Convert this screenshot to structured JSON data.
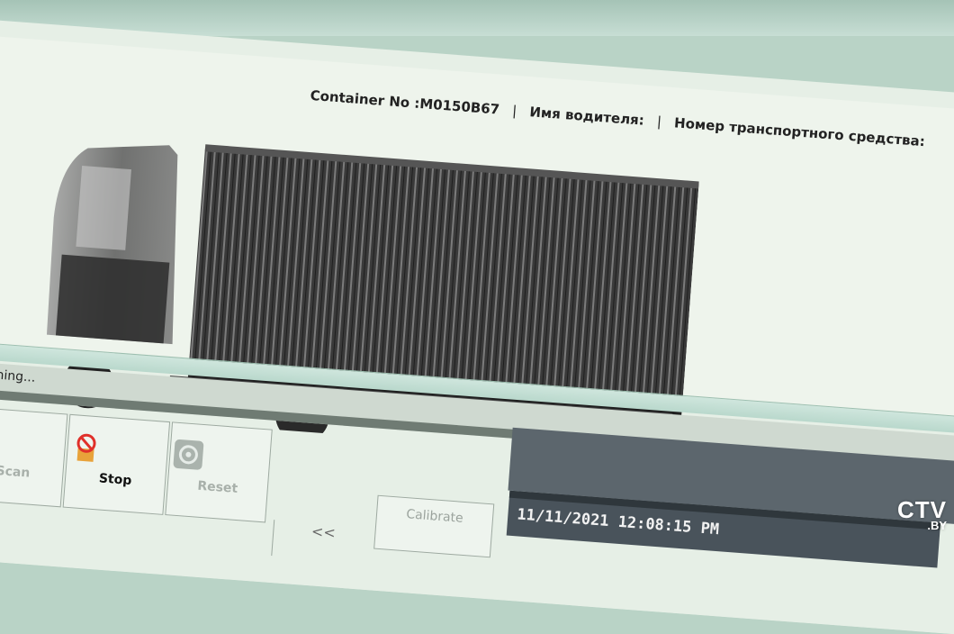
{
  "scan_window": {
    "info_bar": {
      "container_label": "Container No :M0150B67",
      "separator": "|",
      "driver_label": "Имя водителя:",
      "vehicle_label": "Номер транспортного средства:"
    },
    "status": "Scaning...",
    "datetime": "11/11/2021 12:08:15 PM"
  },
  "toolbar": {
    "scan_label": "Scan",
    "stop_label": "Stop",
    "reset_label": "Reset",
    "calibrate_label": "Calibrate",
    "prev_label": "<<"
  },
  "icons": {
    "scan": "joystick-icon",
    "stop": "no-entry-icon",
    "reset": "reset-icon",
    "scroll_left": "arrow-left-icon"
  },
  "watermark": {
    "main": "CTV",
    "sub": ".BY"
  },
  "colors": {
    "stop_icon": "#e0302a",
    "status_bar": "#6f7b73",
    "datetime_bg": "#49535b"
  }
}
